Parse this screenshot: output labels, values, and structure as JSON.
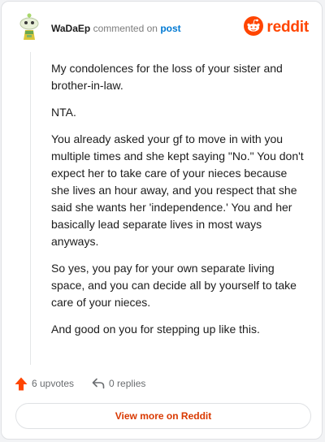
{
  "header": {
    "username": "WaDaEp",
    "action_text": "commented on",
    "post_link": "post",
    "brand_name": "reddit",
    "avatar_icon": "snoo-avatar-icon",
    "brand_icon": "reddit-logo-icon"
  },
  "comment": {
    "paragraphs": [
      "My condolences for the loss of your sister and brother-in-law.",
      "NTA.",
      "You already asked your gf to move in with you multiple times and she kept saying \"No.\" You don't expect her to take care of your nieces because she lives an hour away, and you respect that she said she wants her 'independence.' You and her basically lead separate lives in most ways anyways.",
      "So yes, you pay for your own separate living space, and you can decide all by yourself to take care of your nieces.",
      "And good on you for stepping up like this."
    ]
  },
  "actions": {
    "upvotes": "6 upvotes",
    "replies": "0 replies",
    "upvote_icon": "upvote-arrow-icon",
    "reply_icon": "reply-icon"
  },
  "footer": {
    "view_more": "View more on Reddit"
  },
  "colors": {
    "brand": "#ff4500",
    "link": "#0079d3",
    "button_text": "#d93900",
    "text": "#1c1c1c",
    "muted": "#7c7c7c"
  }
}
